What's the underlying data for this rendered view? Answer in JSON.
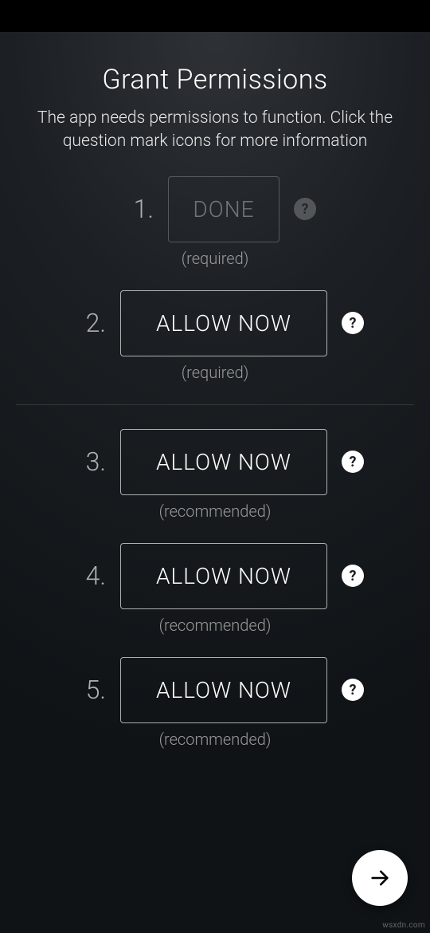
{
  "header": {
    "title": "Grant Permissions",
    "subtitle": "The app needs permissions to function. Click the question mark icons for more information"
  },
  "labels": {
    "required": "(required)",
    "recommended": "(recommended)"
  },
  "items": [
    {
      "num": "1.",
      "button": "DONE",
      "state": "done",
      "hint": "required",
      "help": "dim"
    },
    {
      "num": "2.",
      "button": "ALLOW NOW",
      "state": "active",
      "hint": "required",
      "help": "bright"
    },
    {
      "num": "3.",
      "button": "ALLOW NOW",
      "state": "active",
      "hint": "recommended",
      "help": "bright"
    },
    {
      "num": "4.",
      "button": "ALLOW NOW",
      "state": "active",
      "hint": "recommended",
      "help": "bright"
    },
    {
      "num": "5.",
      "button": "ALLOW NOW",
      "state": "active",
      "hint": "recommended",
      "help": "bright"
    }
  ],
  "watermark": "wsxdn.com"
}
